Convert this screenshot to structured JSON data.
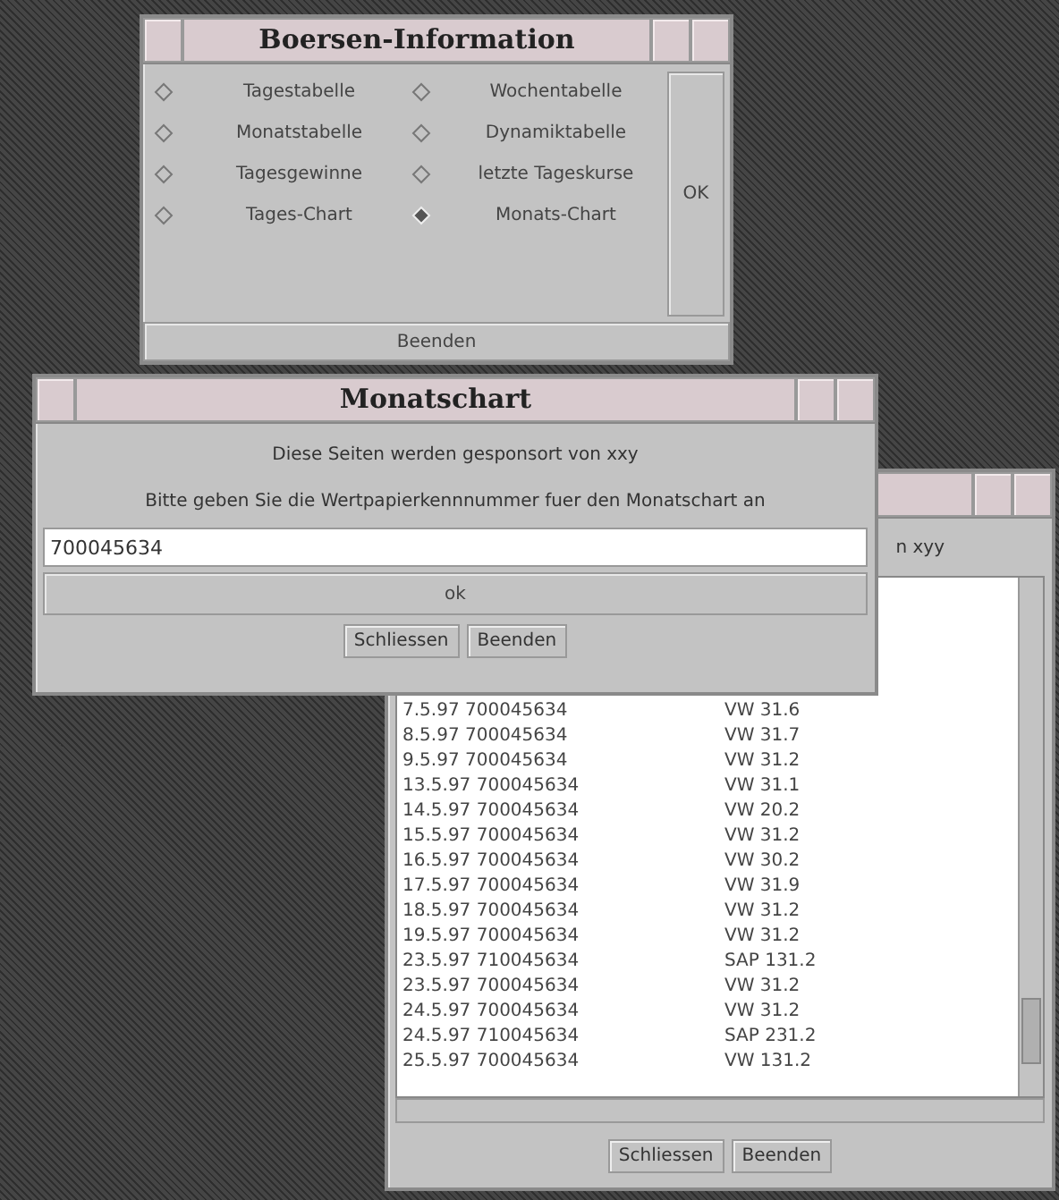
{
  "info_window": {
    "title": "Boersen-Information",
    "options": [
      {
        "label": "Tagestabelle",
        "selected": false
      },
      {
        "label": "Wochentabelle",
        "selected": false
      },
      {
        "label": "Monatstabelle",
        "selected": false
      },
      {
        "label": "Dynamiktabelle",
        "selected": false
      },
      {
        "label": "Tagesgewinne",
        "selected": false
      },
      {
        "label": "letzte Tageskurse",
        "selected": false
      },
      {
        "label": "Tages-Chart",
        "selected": false
      },
      {
        "label": "Monats-Chart",
        "selected": true
      }
    ],
    "ok_button": "OK",
    "quit_button": "Beenden"
  },
  "list_window": {
    "sponsor_fragment": "n xyy",
    "rows": [
      {
        "date": "7.5.97",
        "number": "700045634",
        "value": "VW 31.6"
      },
      {
        "date": "8.5.97",
        "number": "700045634",
        "value": "VW 31.7"
      },
      {
        "date": "9.5.97",
        "number": "700045634",
        "value": "VW 31.2"
      },
      {
        "date": "13.5.97",
        "number": "700045634",
        "value": "VW 31.1"
      },
      {
        "date": "14.5.97",
        "number": "700045634",
        "value": "VW 20.2"
      },
      {
        "date": "15.5.97",
        "number": "700045634",
        "value": "VW 31.2"
      },
      {
        "date": "16.5.97",
        "number": "700045634",
        "value": "VW 30.2"
      },
      {
        "date": "17.5.97",
        "number": "700045634",
        "value": "VW 31.9"
      },
      {
        "date": "18.5.97",
        "number": "700045634",
        "value": "VW 31.2"
      },
      {
        "date": "19.5.97",
        "number": "700045634",
        "value": "VW 31.2"
      },
      {
        "date": "23.5.97",
        "number": "710045634",
        "value": "SAP 131.2"
      },
      {
        "date": "23.5.97",
        "number": "700045634",
        "value": "VW 31.2"
      },
      {
        "date": "24.5.97",
        "number": "700045634",
        "value": "VW 31.2"
      },
      {
        "date": "24.5.97",
        "number": "710045634",
        "value": "SAP 231.2"
      },
      {
        "date": "25.5.97",
        "number": "700045634",
        "value": "VW 131.2"
      }
    ],
    "buttons": [
      "Schliessen",
      "Beenden"
    ]
  },
  "chart_window": {
    "title": "Monatschart",
    "sponsor": "Diese Seiten werden gesponsort von xxy",
    "prompt": "Bitte geben Sie die Wertpapierkennnummer fuer den Monatschart an",
    "input_value": "700045634",
    "ok_button": "ok",
    "buttons": [
      "Schliessen",
      "Beenden"
    ]
  }
}
